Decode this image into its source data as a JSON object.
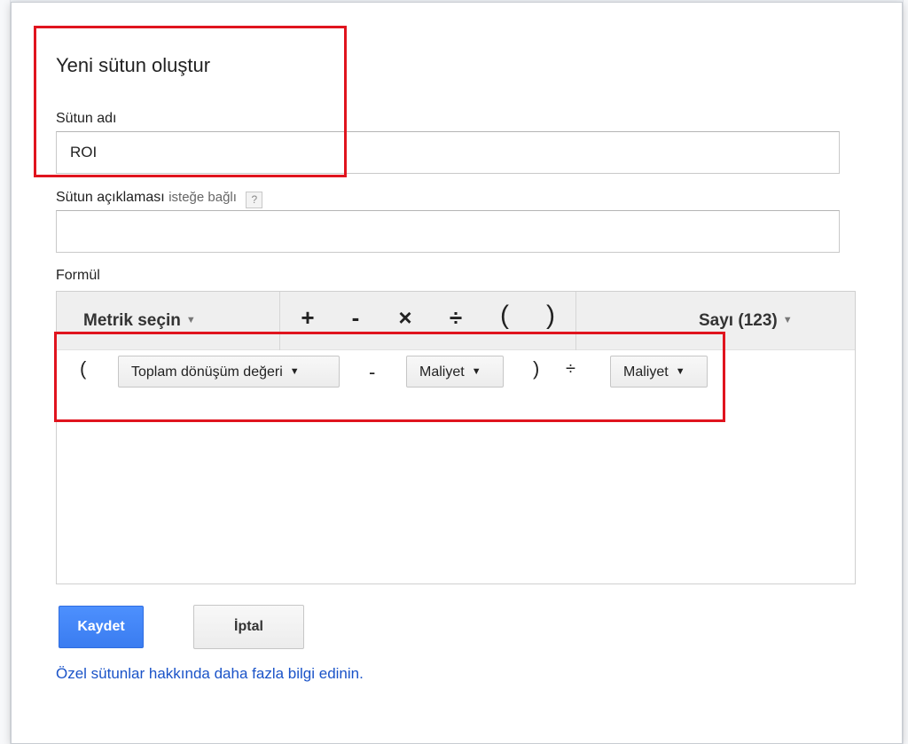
{
  "dialog": {
    "title": "Yeni sütun oluştur",
    "column_name": {
      "label": "Sütun adı",
      "value": "ROI"
    },
    "column_description": {
      "label": "Sütun açıklaması",
      "optional": "isteğe bağlı",
      "help": "?",
      "value": ""
    },
    "formula": {
      "label": "Formül",
      "toolbar": {
        "metric_select": "Metrik seçin",
        "operators": [
          "+",
          "-",
          "×",
          "÷",
          "(",
          ")"
        ],
        "number_select": "Sayı (123)"
      },
      "expression": {
        "open_paren": "(",
        "token1": "Toplam dönüşüm değeri",
        "minus": "-",
        "token2": "Maliyet",
        "close_paren": ")",
        "divide": "÷",
        "token3": "Maliyet"
      }
    },
    "buttons": {
      "save": "Kaydet",
      "cancel": "İptal"
    },
    "learn_more": "Özel sütunlar hakkında daha fazla bilgi edinin."
  },
  "colors": {
    "accent": "#4d90fe",
    "link": "#1a53c8",
    "highlight": "#e0141e"
  }
}
